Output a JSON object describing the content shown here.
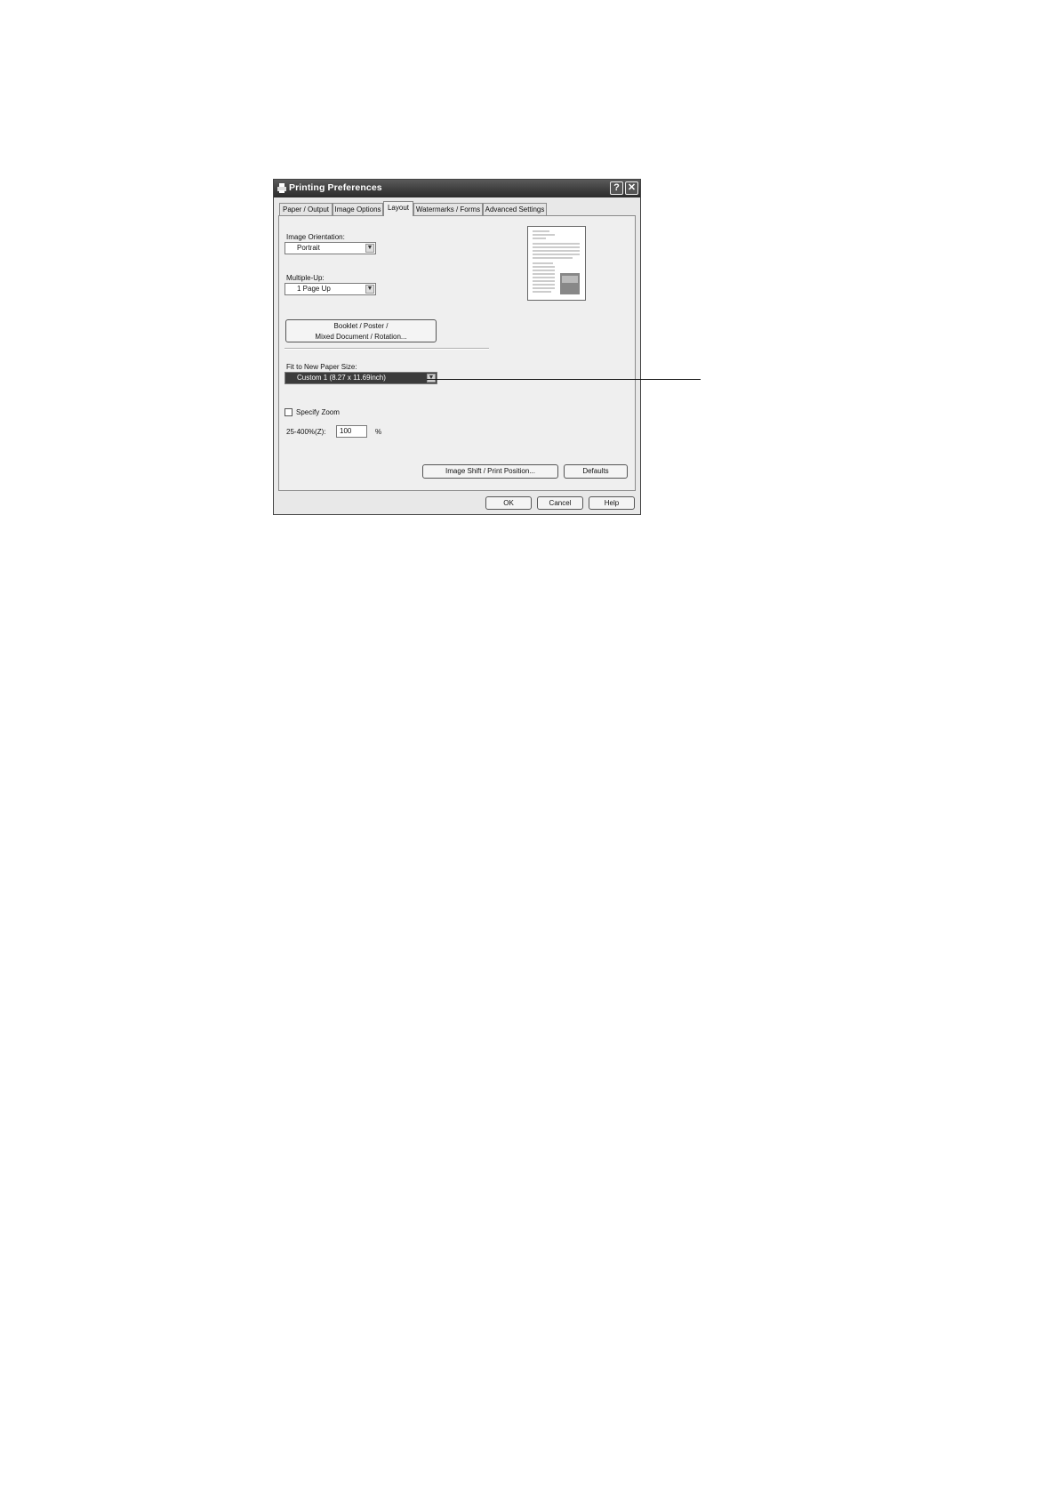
{
  "dialog": {
    "title": "Printing Preferences",
    "help_btn": "?",
    "close_btn": "✕"
  },
  "tabs": [
    {
      "label": "Paper / Output"
    },
    {
      "label": "Image Options"
    },
    {
      "label": "Layout",
      "active": true
    },
    {
      "label": "Watermarks / Forms"
    },
    {
      "label": "Advanced Settings"
    }
  ],
  "layout": {
    "orientation_label": "Image Orientation:",
    "orientation_value": "Portrait",
    "multiple_up_label": "Multiple-Up:",
    "multiple_up_value": "1 Page Up",
    "booklet_line1": "Booklet / Poster /",
    "booklet_line2": "Mixed Document / Rotation...",
    "fit_label": "Fit to New Paper Size:",
    "fit_value": "Custom 1 (8.27 x 11.69inch)",
    "specify_zoom_label": "Specify Zoom",
    "zoom_range_label": "25-400%(Z):",
    "zoom_value": "100",
    "zoom_unit": "%",
    "image_shift_btn": "Image Shift / Print Position...",
    "defaults_btn": "Defaults"
  },
  "footer": {
    "ok": "OK",
    "cancel": "Cancel",
    "help": "Help"
  }
}
